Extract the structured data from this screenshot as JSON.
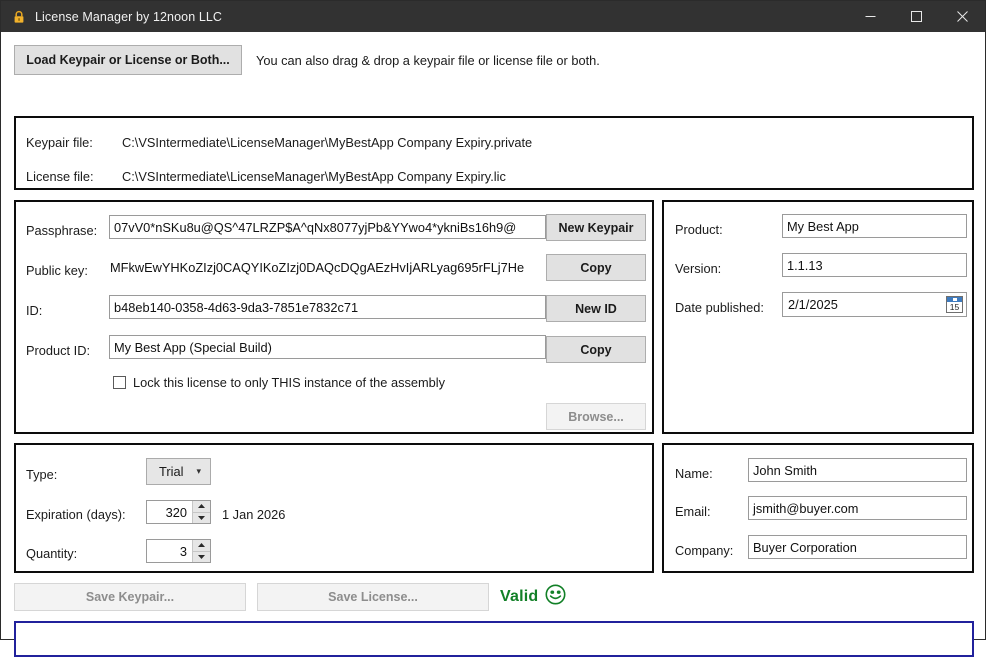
{
  "window": {
    "title": "License Manager by 12noon LLC",
    "icon": "lock-icon",
    "controls": {
      "minimize": "–",
      "maximize": "□",
      "close": "✕"
    }
  },
  "toolbar": {
    "load_button": "Load Keypair or License or Both...",
    "hint": "You can also drag & drop a keypair file or license file or both."
  },
  "files": {
    "keypair_label": "Keypair file:",
    "keypair_path": "C:\\VSIntermediate\\LicenseManager\\MyBestApp Company Expiry.private",
    "license_label": "License file:",
    "license_path": "C:\\VSIntermediate\\LicenseManager\\MyBestApp Company Expiry.lic"
  },
  "keypair": {
    "passphrase_label": "Passphrase:",
    "passphrase_value": "07vV0*nSKu8u@QS^47LRZP$A^qNx8077yjPb&YYwo4*ykniBs16h9@",
    "publickey_label": "Public key:",
    "publickey_value": "MFkwEwYHKoZIzj0CAQYIKoZIzj0DAQcDQgAEzHvIjARLyag695rFLj7He",
    "id_label": "ID:",
    "id_value": "b48eb140-0358-4d63-9da3-7851e7832c71",
    "productid_label": "Product ID:",
    "productid_value": "My Best App (Special Build)",
    "lock_checkbox_label": "Lock this license to only THIS instance of the assembly",
    "lock_checkbox_checked": false,
    "new_keypair_button": "New Keypair",
    "copy_publickey_button": "Copy",
    "new_id_button": "New ID",
    "copy_productid_button": "Copy",
    "browse_button": "Browse..."
  },
  "product": {
    "product_label": "Product:",
    "product_value": "My Best App",
    "version_label": "Version:",
    "version_value": "1.1.13",
    "date_label": "Date published:",
    "date_value": "2/1/2025",
    "calendar_day": "15"
  },
  "license": {
    "type_label": "Type:",
    "type_value": "Trial",
    "expiration_label": "Expiration (days):",
    "expiration_value": "320",
    "expiration_date": "1 Jan 2026",
    "quantity_label": "Quantity:",
    "quantity_value": "3"
  },
  "buyer": {
    "name_label": "Name:",
    "name_value": "John Smith",
    "email_label": "Email:",
    "email_value": "jsmith@buyer.com",
    "company_label": "Company:",
    "company_value": "Buyer Corporation"
  },
  "footer": {
    "save_keypair_button": "Save Keypair...",
    "save_license_button": "Save License...",
    "status_text": "Valid",
    "status_icon": "smiley-face-icon",
    "status_color": "#128027",
    "message_value": ""
  }
}
